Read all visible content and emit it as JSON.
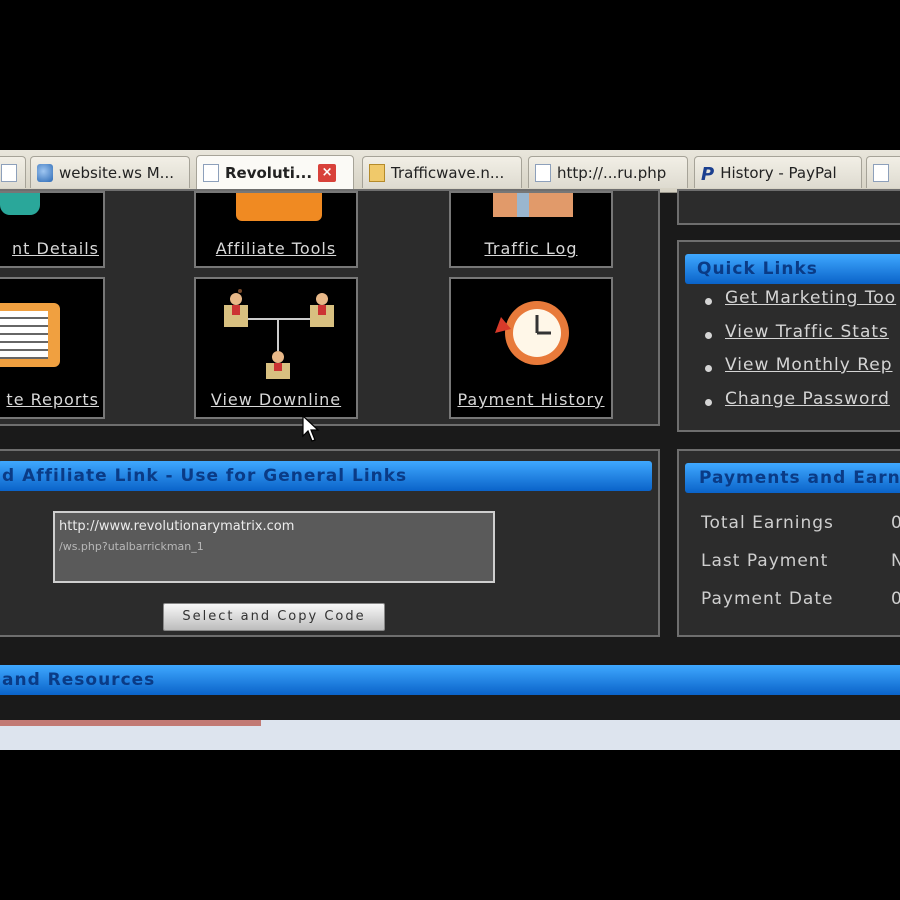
{
  "browser": {
    "tabs": [
      {
        "label": "",
        "icon": "page-icon"
      },
      {
        "label": "website.ws M...",
        "icon": "globe-icon"
      },
      {
        "label": "Revoluti...",
        "icon": "page-icon",
        "active": true
      },
      {
        "label": "Trafficwave.n...",
        "icon": "folder-icon"
      },
      {
        "label": "http://...ru.php",
        "icon": "page-icon"
      },
      {
        "label": "History - PayPal",
        "icon": "P"
      },
      {
        "label": "",
        "icon": "page-icon"
      }
    ]
  },
  "tiles": {
    "account_details": "nt Details",
    "affiliate_tools": "Affiliate Tools",
    "traffic_log": "Traffic Log",
    "reports": "te Reports",
    "view_downline": "View Downline",
    "payment_history": "Payment History"
  },
  "affiliate_link": {
    "header": "d Affiliate Link - Use for General Links",
    "line1": "http://www.revolutionarymatrix.com",
    "line2": "/ws.php?utalbarrickman_1",
    "copy_button": "Select and Copy Code"
  },
  "quick_links": {
    "header": "Quick Links",
    "items": [
      "Get Marketing Too",
      "View Traffic Stats",
      "View Monthly Rep",
      "Change Password"
    ]
  },
  "earnings": {
    "header": "Payments and Earni",
    "rows": [
      {
        "label": "Total Earnings",
        "value": "0"
      },
      {
        "label": "Last Payment",
        "value": "N"
      },
      {
        "label": "Payment Date",
        "value": "0"
      }
    ]
  },
  "resources": {
    "header": "and Resources"
  },
  "status": {
    "progress_fraction": 0.29
  },
  "colors": {
    "bar_blue": "#0a63c9",
    "bar_text": "#0a3b86"
  }
}
